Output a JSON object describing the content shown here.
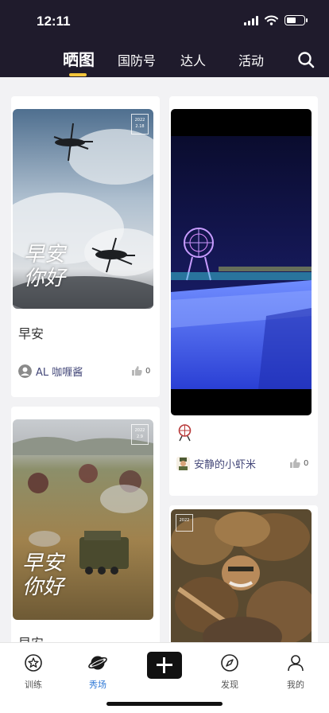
{
  "status_bar": {
    "time": "12:11"
  },
  "top_tabs": [
    {
      "label": "晒图",
      "active": true
    },
    {
      "label": "国防号",
      "active": false
    },
    {
      "label": "达人",
      "active": false
    },
    {
      "label": "活动",
      "active": false
    }
  ],
  "posts": [
    {
      "title": "早安",
      "author": "AL 咖喱酱",
      "likes": "0",
      "image_text": {
        "stamp": [
          "2022",
          "2.18"
        ],
        "line1": "早安",
        "line2": "你好"
      }
    },
    {
      "title": "",
      "author": "安静的小虾米",
      "likes": "0"
    },
    {
      "title": "早安",
      "image_text": {
        "stamp": [
          "2022",
          "2.9"
        ],
        "line1": "早安",
        "line2": "你好"
      }
    },
    {
      "title": "",
      "image_text": {
        "stamp": [
          "2022"
        ]
      }
    }
  ],
  "bottom_nav": [
    {
      "label": "训练",
      "icon": "star-circle-icon",
      "active": false
    },
    {
      "label": "秀场",
      "icon": "planet-icon",
      "active": true
    },
    {
      "label": "",
      "icon": "plus-icon",
      "active": false
    },
    {
      "label": "发现",
      "icon": "compass-icon",
      "active": false
    },
    {
      "label": "我的",
      "icon": "user-icon",
      "active": false
    }
  ],
  "colors": {
    "header_bg": "#1f1b2c",
    "accent_yellow": "#f3c53a",
    "active_blue": "#2f78d6",
    "author_text": "#45497a"
  }
}
